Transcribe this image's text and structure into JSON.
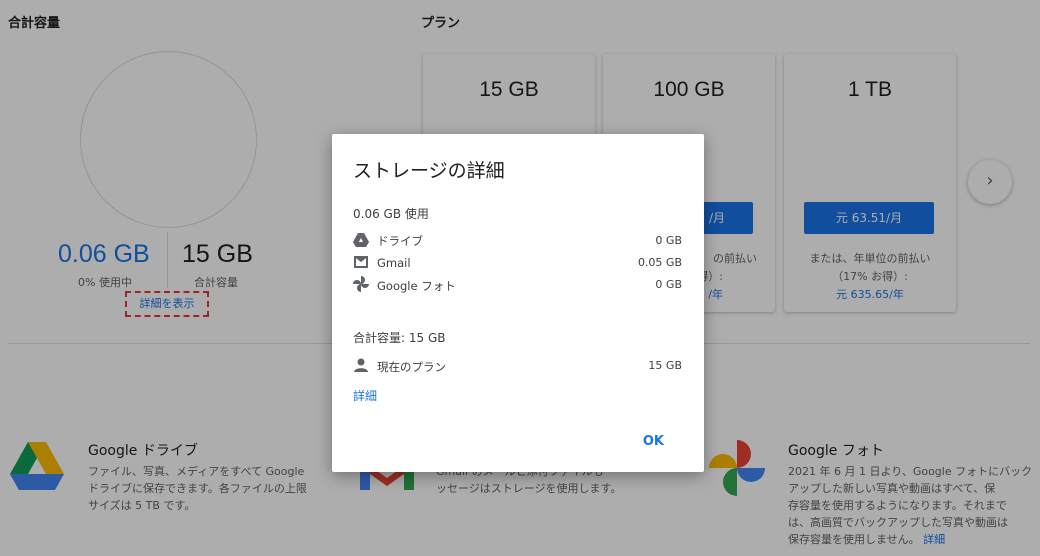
{
  "storage": {
    "section_title": "合計容量",
    "used_value": "0.06 GB",
    "used_label": "0% 使用中",
    "total_value": "15 GB",
    "total_label": "合計容量",
    "details_link": "詳細を表示"
  },
  "plans": {
    "section_title": "プラン",
    "cards": [
      {
        "size": "15 GB"
      },
      {
        "size": "100 GB",
        "price_partial": "/月",
        "note_line1": "の前払い",
        "note_line2": "得）:",
        "annual_partial": "/年"
      },
      {
        "size": "1 TB",
        "price": "元 63.51/月",
        "note_line1": "または、年単位の前払い",
        "note_line2": "（17% お得）:",
        "annual": "元 635.65/年"
      }
    ],
    "next_icon": "chevron-right-icon"
  },
  "products": [
    {
      "title": "Google ドライブ",
      "desc": [
        "ファイル、写真、メディアをすべて Google",
        "ドライブに保存できます。各ファイルの上限",
        "サイズは 5 TB です。"
      ]
    },
    {
      "title": "",
      "desc": [
        "Gmail のメールと添付ファイルも",
        "ッセージはストレージを使用します。"
      ]
    },
    {
      "title": "Google フォト",
      "desc": [
        "2021 年 6 月 1 日より、Google フォトにバック",
        "アップした新しい写真や動画はすべて、保",
        "存容量を使用するようになります。それまで",
        "は、高画質でバックアップした写真や動画は",
        "保存容量を使用しません。"
      ],
      "link": "詳細"
    }
  ],
  "dialog": {
    "title": "ストレージの詳細",
    "used_heading": "0.06 GB 使用",
    "usage_rows": [
      {
        "icon": "drive-icon",
        "label": "ドライブ",
        "value": "0 GB"
      },
      {
        "icon": "gmail-icon",
        "label": "Gmail",
        "value": "0.05 GB"
      },
      {
        "icon": "photos-icon",
        "label": "Google フォト",
        "value": "0 GB"
      }
    ],
    "total_heading": "合計容量: 15 GB",
    "plan_row": {
      "icon": "person-icon",
      "label": "現在のプラン",
      "value": "15 GB"
    },
    "details_link": "詳細",
    "ok_button": "OK"
  },
  "colors": {
    "accent": "#1a73e8",
    "highlight_box": "#e53935",
    "overlay": "rgba(0,0,0,0.32)"
  }
}
